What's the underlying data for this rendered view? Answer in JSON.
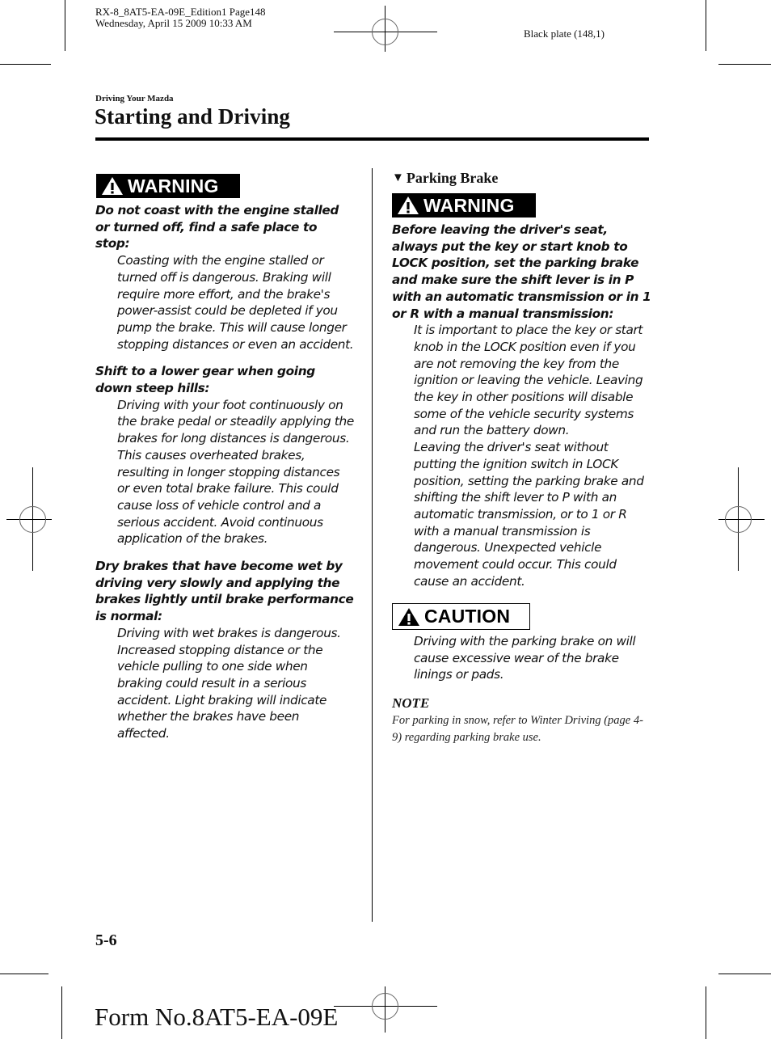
{
  "print_slug": {
    "line1": "RX-8_8AT5-EA-09E_Edition1 Page148",
    "line2": "Wednesday, April 15 2009 10:33 AM"
  },
  "plate_label": "Black plate (148,1)",
  "header": {
    "section": "Driving Your Mazda",
    "title": "Starting and Driving"
  },
  "left_column": {
    "warning_badge": "WARNING",
    "warnings": [
      {
        "lead": "Do not coast with the engine stalled or turned off, find a safe place to stop:",
        "body": "Coasting with the engine stalled or turned off is dangerous. Braking will require more effort, and the brake's power-assist could be depleted if you pump the brake. This will cause longer stopping distances or even an accident."
      },
      {
        "lead": "Shift to a lower gear when going down steep hills:",
        "body": "Driving with your foot continuously on the brake pedal or steadily applying the brakes for long distances is dangerous. This causes overheated brakes, resulting in longer stopping distances or even total brake failure. This could cause loss of vehicle control and a serious accident. Avoid continuous application of the brakes."
      },
      {
        "lead": "Dry brakes that have become wet by driving very slowly and applying the brakes lightly until brake performance is normal:",
        "body": "Driving with wet brakes is dangerous. Increased stopping distance or the vehicle pulling to one side when braking could result in a serious accident. Light braking will indicate whether the brakes have been affected."
      }
    ]
  },
  "right_column": {
    "subheading_marker": "▼",
    "subheading": "Parking Brake",
    "warning_badge": "WARNING",
    "warning": {
      "lead": "Before leaving the driver's seat, always put the key or start knob to LOCK position, set the parking brake and make sure the shift lever is in P with an automatic transmission or in 1 or R with a manual transmission:",
      "body1": "It is important to place the key or start knob in the LOCK position even if you are not removing the key from the ignition or leaving the vehicle. Leaving the key in other positions will disable some of the vehicle security systems and run the battery down.",
      "body2": "Leaving the driver's seat without putting the ignition switch in LOCK position, setting the parking brake and shifting the shift lever to P with an automatic transmission, or to 1 or R with a manual transmission is dangerous. Unexpected vehicle movement could occur. This could cause an accident."
    },
    "caution_badge": "CAUTION",
    "caution_body": "Driving with the parking brake on will cause excessive wear of the brake linings or pads.",
    "note_heading": "NOTE",
    "note_body": "For parking in snow, refer to Winter Driving (page 4-9) regarding parking brake use."
  },
  "footer": {
    "page_number": "5-6",
    "form_number": "Form No.8AT5-EA-09E"
  },
  "icons": {
    "warning_badge_icon": "warning-triangle-icon",
    "caution_badge_icon": "warning-triangle-icon",
    "subheading_icon": "down-triangle-icon",
    "registration_marks": "crosshair-registration-icon"
  }
}
